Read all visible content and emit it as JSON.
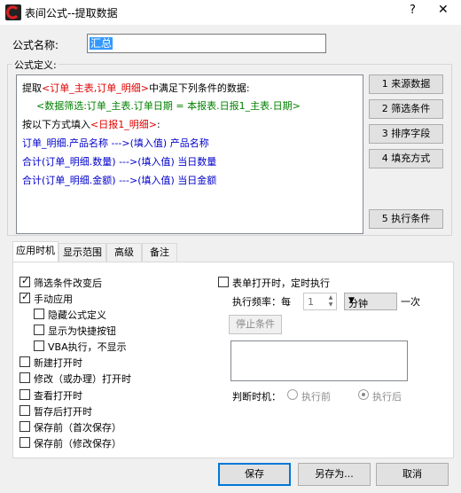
{
  "window": {
    "title": "表间公式--提取数据",
    "help": "?",
    "close": "✕"
  },
  "formula_name": {
    "label": "公式名称:",
    "value": "汇总"
  },
  "definition": {
    "label": "公式定义:",
    "line1": {
      "a": "提取",
      "b": "<订单_主表,订单_明细>",
      "c": "中满足下列条件的数据:"
    },
    "line2": "<数据筛选:订单_主表.订单日期 = 本报表.日报1_主表.日期>",
    "line3": {
      "a": "按以下方式填入",
      "b": "<日报1_明细>",
      "c": ":"
    },
    "rows": [
      "订单_明细.产品名称  --->(填入值)  产品名称",
      "合计(订单_明细.数量)  --->(填入值)  当日数量",
      "合计(订单_明细.金额)  --->(填入值)  当日金额"
    ]
  },
  "side_buttons": [
    "1  来源数据",
    "2  筛选条件",
    "3  排序字段",
    "4 填充方式",
    "5 执行条件"
  ],
  "tabs": [
    "应用时机",
    "显示范围",
    "高级",
    "备注"
  ],
  "timing": {
    "filter_changed": "筛选条件改变后",
    "manual": "手动应用",
    "hide_formula": "隐藏公式定义",
    "shortcut": "显示为快捷按钮",
    "vba": "VBA执行，不显示",
    "on_new": "新建打开时",
    "on_edit": "修改（或办理）打开时",
    "on_view": "查看打开时",
    "on_draft": "暂存后打开时",
    "before_save_first": "保存前（首次保存）",
    "before_save_edit": "保存前（修改保存）"
  },
  "timer": {
    "label": "表单打开时，定时执行",
    "freq_label": "执行频率：每",
    "freq_value": "1",
    "unit": "分钟",
    "once": "一次",
    "stop": "停止条件",
    "judge_label": "判断时机：",
    "before": "执行前",
    "after": "执行后"
  },
  "buttons": {
    "save": "保存",
    "save_as": "另存为...",
    "cancel": "取消"
  },
  "colors": {
    "accent": "#0078d7",
    "field": "#e00000",
    "filter": "#008000",
    "mapping": "#0000cc"
  }
}
